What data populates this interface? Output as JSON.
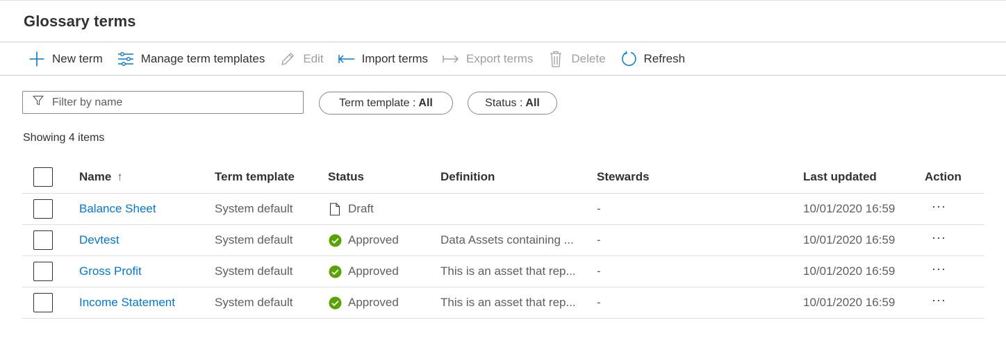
{
  "page": {
    "title": "Glossary terms"
  },
  "toolbar": {
    "new_term": {
      "label": "New term",
      "icon": "plus-icon",
      "enabled": true
    },
    "manage_templates": {
      "label": "Manage term templates",
      "icon": "sliders-icon",
      "enabled": true
    },
    "edit": {
      "label": "Edit",
      "icon": "pencil-icon",
      "enabled": false
    },
    "import_terms": {
      "label": "Import terms",
      "icon": "import-arrow-icon",
      "enabled": true
    },
    "export_terms": {
      "label": "Export terms",
      "icon": "export-arrow-icon",
      "enabled": false
    },
    "delete": {
      "label": "Delete",
      "icon": "trash-icon",
      "enabled": false
    },
    "refresh": {
      "label": "Refresh",
      "icon": "refresh-icon",
      "enabled": true
    }
  },
  "filters": {
    "search_placeholder": "Filter by name",
    "search_value": "",
    "term_template": {
      "label": "Term template :",
      "value": "All"
    },
    "status": {
      "label": "Status :",
      "value": "All"
    }
  },
  "summary": {
    "showing": "Showing 4 items"
  },
  "table": {
    "columns": {
      "name": "Name",
      "name_sort": "↑",
      "term_template": "Term template",
      "status": "Status",
      "definition": "Definition",
      "stewards": "Stewards",
      "last_updated": "Last updated",
      "action": "Action"
    },
    "rows": [
      {
        "name": "Balance Sheet",
        "term_template": "System default",
        "status": "Draft",
        "status_icon": "document-icon",
        "definition": "",
        "stewards": "-",
        "last_updated": "10/01/2020 16:59",
        "action": "···"
      },
      {
        "name": "Devtest",
        "term_template": "System default",
        "status": "Approved",
        "status_icon": "check-circle-icon",
        "definition": "Data Assets containing ...",
        "stewards": "-",
        "last_updated": "10/01/2020 16:59",
        "action": "···"
      },
      {
        "name": "Gross Profit",
        "term_template": "System default",
        "status": "Approved",
        "status_icon": "check-circle-icon",
        "definition": "This is an asset that rep...",
        "stewards": "-",
        "last_updated": "10/01/2020 16:59",
        "action": "···"
      },
      {
        "name": "Income Statement",
        "term_template": "System default",
        "status": "Approved",
        "status_icon": "check-circle-icon",
        "definition": "This is an asset that rep...",
        "stewards": "-",
        "last_updated": "10/01/2020 16:59",
        "action": "···"
      }
    ]
  },
  "colors": {
    "accent": "#0078d4",
    "approved": "#57a300",
    "disabled": "#a19f9d",
    "text": "#323130"
  }
}
